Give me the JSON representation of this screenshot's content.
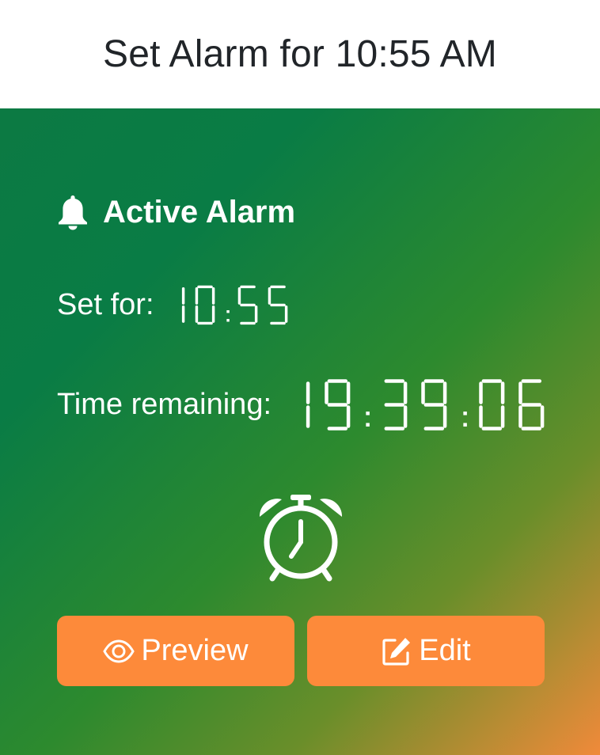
{
  "header": {
    "title": "Set Alarm for 10:55 AM"
  },
  "alarm": {
    "status_label": "Active Alarm",
    "set_for_label": "Set for:",
    "set_time": "10:55",
    "remaining_label": "Time remaining:",
    "remaining_time": "19:39:06",
    "status_icon": "bell-icon",
    "clock_icon": "alarm-clock-icon"
  },
  "actions": {
    "preview_label": "Preview",
    "preview_icon": "eye-icon",
    "edit_label": "Edit",
    "edit_icon": "edit-icon"
  },
  "colors": {
    "gradient_start": "#0c7a43",
    "gradient_end": "#f08a3a",
    "button": "#fd8a3a",
    "text_on_card": "#ffffff",
    "header_text": "#212529"
  }
}
